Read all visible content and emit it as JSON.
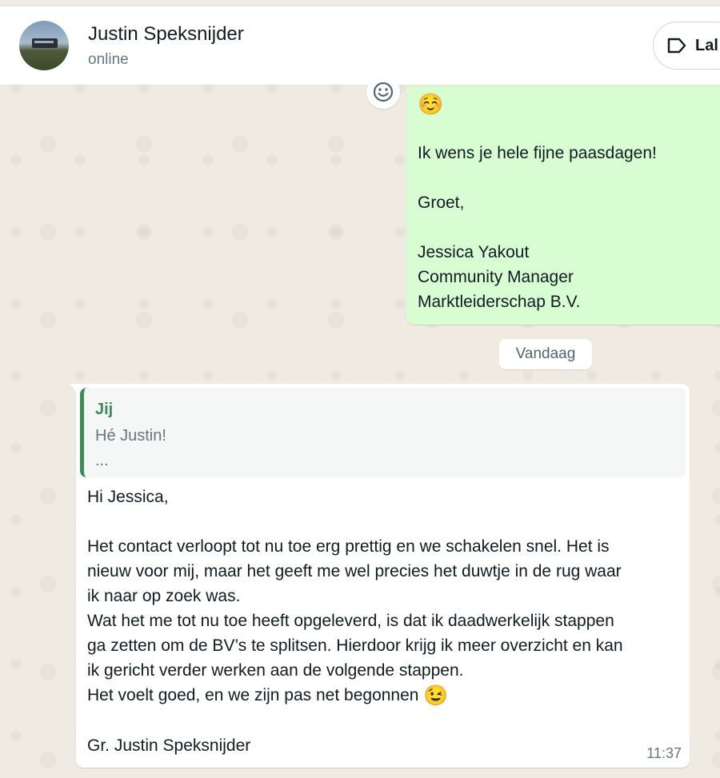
{
  "header": {
    "contact_name": "Justin Speksnijder",
    "status": "online",
    "label_button": "Lal"
  },
  "outgoing_message": {
    "emoji": "☺️",
    "lines": [
      "Ik wens je hele fijne paasdagen!",
      "Groet,",
      "Jessica Yakout",
      "Community Manager",
      "Marktleiderschap B.V."
    ]
  },
  "day_divider": "Vandaag",
  "incoming_message": {
    "quote": {
      "author": "Jij",
      "text": "Hé Justin!",
      "ellipsis": "..."
    },
    "lines": [
      "Hi Jessica,",
      "",
      "Het contact verloopt tot nu toe erg prettig en we schakelen snel. Het is",
      "nieuw voor mij, maar het geeft me wel precies het duwtje in de rug waar",
      "ik naar op zoek was.",
      "Wat het me tot nu toe heeft opgeleverd, is dat ik daadwerkelijk stappen",
      "ga zetten om de BV’s te splitsen. Hierdoor krijg ik meer overzicht en kan",
      "ik gericht verder werken aan de volgende stappen.",
      "Het voelt goed, en we zijn pas net begonnen",
      "",
      "Gr. Justin Speksnijder"
    ],
    "inline_emoji": "😉",
    "time": "11:37"
  },
  "colors": {
    "outgoing_bubble": "#d9fdd3",
    "incoming_bubble": "#ffffff",
    "quote_accent": "#3d8b5a",
    "chat_background": "#efeae2"
  },
  "icons": {
    "label": "label-tag-icon",
    "react": "emoji-smile-icon"
  }
}
